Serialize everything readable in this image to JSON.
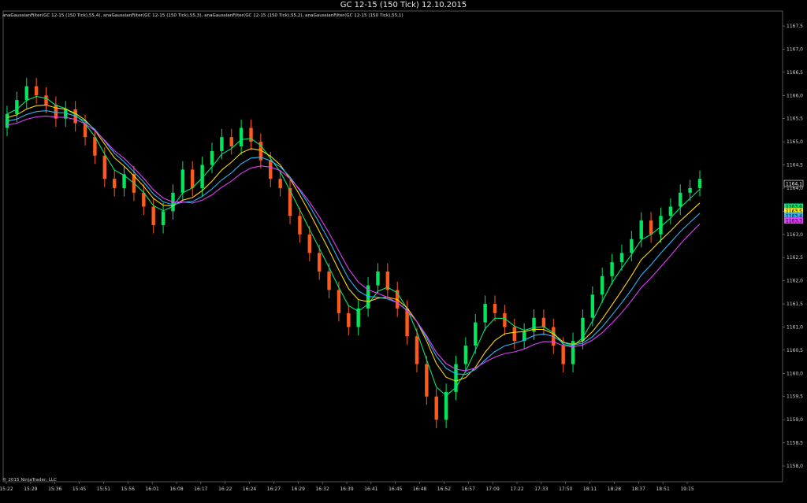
{
  "window": {
    "title": "GC 12-15 (150 Tick)  12.10.2015",
    "indicator_legend": "anaGaussianFilter(GC 12-15 (150 Tick),55,4), anaGaussianFilter(GC 12-15 (150 Tick),55,3), anaGaussianFilter(GC 12-15 (150 Tick),55,2), anaGaussianFilter(GC 12-15 (150 Tick),55,1)",
    "copyright": "© 2015 NinjaTrader, LLC"
  },
  "colors": {
    "background": "#000000",
    "up_candle": "#00e65c",
    "down_candle": "#ff5a1e",
    "doji": "#ffffff",
    "axis": "#8a8a8a",
    "price_badge_bg": "#000000"
  },
  "chart_data": {
    "type": "candlestick",
    "title": "GC 12-15 (150 Tick)  12.10.2015",
    "y_axis_position": "right",
    "ylim": [
      1157.5,
      1168.0
    ],
    "y_ticks": [
      "1167,5",
      "1167,0",
      "1166,5",
      "1166,0",
      "1165,5",
      "1165,0",
      "1164,5",
      "1164,0",
      "1163,5",
      "1163,0",
      "1162,5",
      "1162,0",
      "1161,5",
      "1161,0",
      "1160,5",
      "1160,0",
      "1159,5",
      "1159,0",
      "1158,5",
      "1158,0"
    ],
    "x_ticks": [
      "15:22",
      "15:29",
      "15:36",
      "15:45",
      "15:51",
      "15:56",
      "16:01",
      "16:08",
      "16:17",
      "16:22",
      "16:24",
      "16:27",
      "16:29",
      "16:32",
      "16:39",
      "16:41",
      "16:45",
      "16:48",
      "16:52",
      "16:57",
      "17:09",
      "17:22",
      "17:33",
      "17:50",
      "18:11",
      "18:28",
      "18:37",
      "18:51",
      "19:15"
    ],
    "closes": [
      1165.6,
      1165.9,
      1166.2,
      1166.0,
      1165.8,
      1165.5,
      1165.7,
      1165.4,
      1165.1,
      1164.7,
      1164.2,
      1164.0,
      1164.3,
      1163.9,
      1163.6,
      1163.2,
      1163.5,
      1163.9,
      1164.4,
      1164.0,
      1164.5,
      1164.8,
      1165.1,
      1164.9,
      1165.3,
      1165.0,
      1164.6,
      1164.2,
      1164.0,
      1163.4,
      1163.0,
      1162.6,
      1162.2,
      1161.8,
      1161.3,
      1161.0,
      1161.4,
      1161.9,
      1162.2,
      1161.8,
      1161.4,
      1160.8,
      1160.2,
      1159.5,
      1159.0,
      1159.6,
      1160.2,
      1160.6,
      1161.1,
      1161.5,
      1161.3,
      1161.0,
      1160.7,
      1160.9,
      1161.2,
      1161.0,
      1160.6,
      1160.2,
      1160.7,
      1161.2,
      1161.7,
      1162.1,
      1162.4,
      1162.6,
      1162.9,
      1163.3,
      1163.0,
      1163.4,
      1163.6,
      1163.9,
      1164.0,
      1164.2
    ]
  },
  "price_markers": [
    {
      "price": "1164,1",
      "value": 1164.1,
      "color": "#ffffff"
    },
    {
      "price": "1163,6",
      "value": 1163.6,
      "color": "#00e676"
    },
    {
      "price": "1163,5",
      "value": 1163.5,
      "color": "#ffe600"
    },
    {
      "price": "1163,4",
      "value": 1163.4,
      "color": "#29b6f6"
    },
    {
      "price": "1163,3",
      "value": 1163.3,
      "color": "#e040fb"
    }
  ],
  "filters": [
    {
      "lag": 0,
      "color": "#00e676"
    },
    {
      "lag": 3,
      "color": "#ffd600"
    },
    {
      "lag": 5,
      "color": "#29b6f6"
    },
    {
      "lag": 7,
      "color": "#e040fb"
    }
  ]
}
